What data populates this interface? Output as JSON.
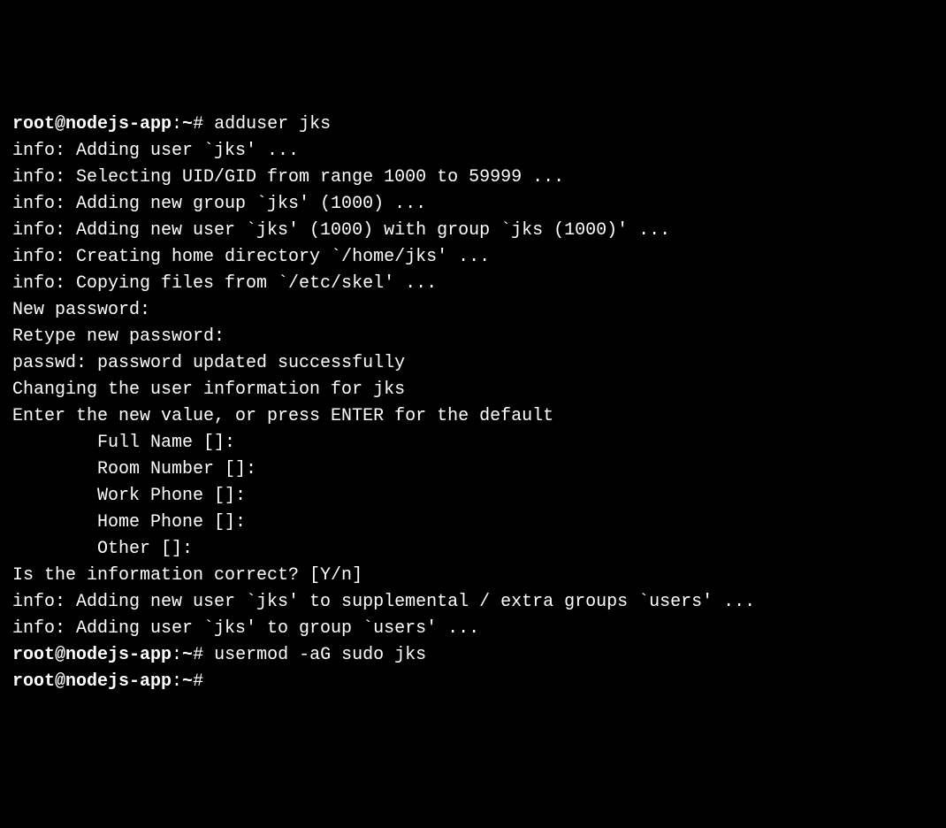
{
  "prompt1": "root@nodejs-app",
  "prompt_sep": ":",
  "prompt_path": "~",
  "prompt_end": "# ",
  "cmd1": "adduser jks",
  "l01": "info: Adding user `jks' ...",
  "l02": "info: Selecting UID/GID from range 1000 to 59999 ...",
  "l03": "info: Adding new group `jks' (1000) ...",
  "l04": "info: Adding new user `jks' (1000) with group `jks (1000)' ...",
  "l05": "info: Creating home directory `/home/jks' ...",
  "l06": "info: Copying files from `/etc/skel' ...",
  "l07": "New password: ",
  "l08": "Retype new password: ",
  "l09": "passwd: password updated successfully",
  "l10": "Changing the user information for jks",
  "l11": "Enter the new value, or press ENTER for the default",
  "l12": "        Full Name []: ",
  "l13": "        Room Number []: ",
  "l14": "        Work Phone []: ",
  "l15": "        Home Phone []: ",
  "l16": "        Other []: ",
  "l17": "Is the information correct? [Y/n] ",
  "l18": "info: Adding new user `jks' to supplemental / extra groups `users' ...",
  "l19": "info: Adding user `jks' to group `users' ...",
  "cmd2": "usermod -aG sudo jks"
}
